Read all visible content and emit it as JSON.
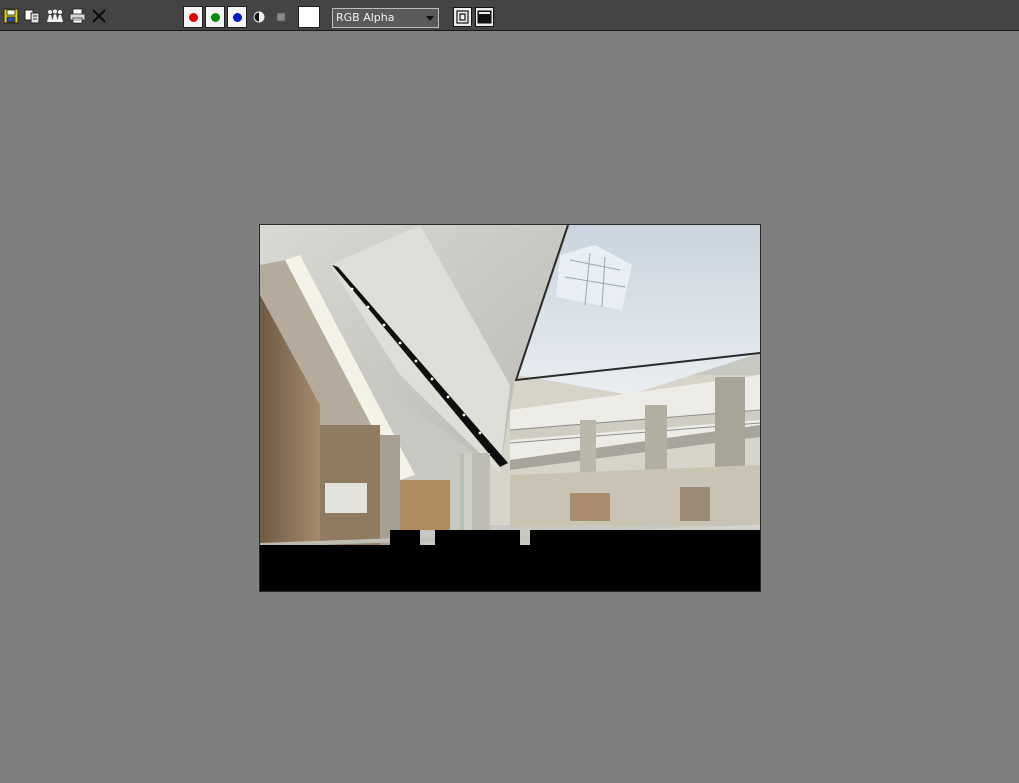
{
  "toolbar": {
    "icons": [
      "save-image-icon",
      "clone-window-icon",
      "track-image-icon",
      "print-image-icon",
      "clear-image-icon"
    ],
    "channels": [
      {
        "name": "red-channel",
        "color": "#e00000"
      },
      {
        "name": "green-channel",
        "color": "#0a8a0a"
      },
      {
        "name": "blue-channel",
        "color": "#0018c8"
      }
    ],
    "display_channel": {
      "selected": "RGB Alpha"
    }
  },
  "colors": {
    "background": "#7f7f7f",
    "toolbar": "#444444"
  }
}
